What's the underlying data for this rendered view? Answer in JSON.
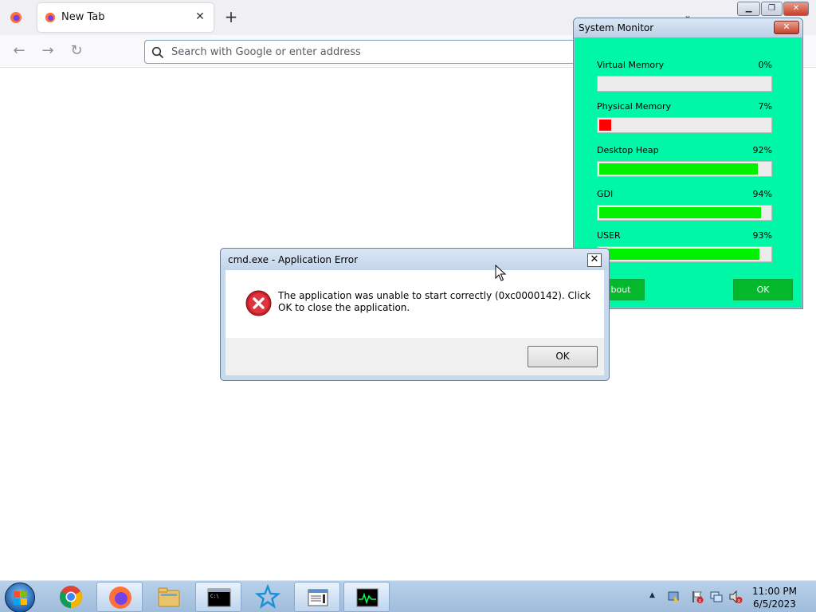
{
  "browser": {
    "tab_title": "New Tab",
    "urlbar_placeholder": "Search with Google or enter address"
  },
  "system_monitor": {
    "title": "System Monitor",
    "meters": [
      {
        "label": "Virtual Memory",
        "value_text": "0%",
        "value": 0,
        "color": "#00f000"
      },
      {
        "label": "Physical Memory",
        "value_text": "7%",
        "value": 7,
        "color": "#ff0000"
      },
      {
        "label": "Desktop Heap",
        "value_text": "92%",
        "value": 92,
        "color": "#00f000"
      },
      {
        "label": "GDI",
        "value_text": "94%",
        "value": 94,
        "color": "#00f000"
      },
      {
        "label": "USER",
        "value_text": "93%",
        "value": 93,
        "color": "#00f000"
      }
    ],
    "about_label": "bout",
    "ok_label": "OK",
    "background_color": "#00f7a6"
  },
  "error_dialog": {
    "title": "cmd.exe - Application Error",
    "message": "The application was unable to start correctly (0xc0000142). Click OK to close the application.",
    "ok_label": "OK"
  },
  "taskbar": {
    "pinned": [
      "chrome-icon",
      "firefox-icon",
      "file-explorer-icon",
      "cmd-icon",
      "star-app-icon",
      "notepad-icon",
      "system-monitor-icon"
    ],
    "clock_time": "11:00 PM",
    "clock_date": "6/5/2023"
  }
}
